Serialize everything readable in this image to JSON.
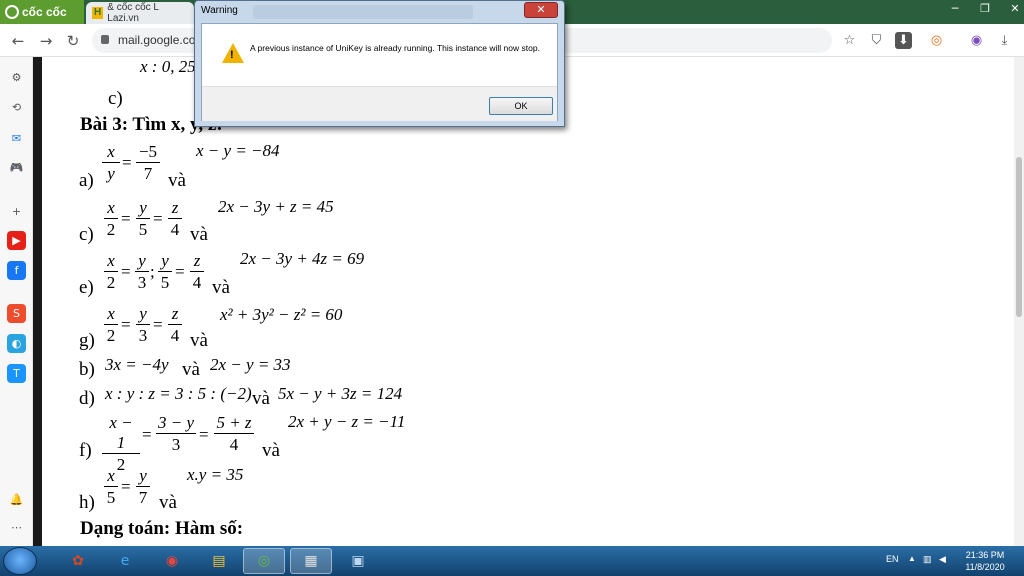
{
  "browser": {
    "brand_label": "cốc cốc",
    "tabs": [
      {
        "label": "& cốc cốc L Lazi.vn",
        "favicon": "H"
      }
    ],
    "window_controls": [
      "─",
      "❐",
      "✕"
    ],
    "url": "mail.google.com",
    "nav": {
      "back": "←",
      "forward": "→",
      "reload": "↻"
    },
    "toolbar_icons": {
      "star": "☆",
      "shield": "⛉",
      "download": "⬇",
      "extension": "◎",
      "account": "◉",
      "save": "⤓"
    }
  },
  "sidebar": {
    "items": [
      {
        "name": "settings-icon",
        "glyph": "⚙",
        "color": "#555555"
      },
      {
        "name": "history-icon",
        "glyph": "⟲",
        "color": "#555555"
      },
      {
        "name": "messenger-icon",
        "glyph": "✉",
        "color": "#1877f2"
      },
      {
        "name": "game-icon",
        "glyph": "🎮",
        "color": "#2e9e4d"
      },
      {
        "name": "add-icon",
        "glyph": "+",
        "color": "#555555"
      },
      {
        "name": "youtube-icon",
        "glyph": "▶",
        "color": "#e62117"
      },
      {
        "name": "facebook-icon",
        "glyph": "f",
        "color": "#1877f2"
      },
      {
        "name": "shopee-icon",
        "glyph": "S",
        "color": "#ee4d2d"
      },
      {
        "name": "app-icon",
        "glyph": "◐",
        "color": "#2aa4e0"
      },
      {
        "name": "tiki-icon",
        "glyph": "T",
        "color": "#1a94ff"
      },
      {
        "name": "notification-icon",
        "glyph": "🔔",
        "color": "#555555"
      },
      {
        "name": "more-icon",
        "glyph": "⋯",
        "color": "#555555"
      }
    ]
  },
  "dialog": {
    "title": "Warning",
    "message": "A previous instance of UniKey is already running. This instance will now stop.",
    "ok_label": "OK",
    "close_glyph": "✕"
  },
  "document": {
    "top_line": "x : 0, 25",
    "c_label_top": "c)",
    "section_title": "Bài 3: Tìm x, y, z:",
    "problems": {
      "a": {
        "label": "a)",
        "frac1": {
          "n": "x",
          "d": "y"
        },
        "frac2": {
          "n": "−5",
          "d": "7"
        },
        "va": "và",
        "cond": "x − y = −84"
      },
      "c": {
        "label": "c)",
        "f1": {
          "n": "x",
          "d": "2"
        },
        "f2": {
          "n": "y",
          "d": "5"
        },
        "f3": {
          "n": "z",
          "d": "4"
        },
        "va": "và",
        "cond": "2x − 3y + z = 45"
      },
      "e": {
        "label": "e)",
        "f1": {
          "n": "x",
          "d": "2"
        },
        "f2": {
          "n": "y",
          "d": "3"
        },
        "f3": {
          "n": "y",
          "d": "5"
        },
        "f4": {
          "n": "z",
          "d": "4"
        },
        "va": "và",
        "cond": "2x − 3y + 4z = 69"
      },
      "g": {
        "label": "g)",
        "f1": {
          "n": "x",
          "d": "2"
        },
        "f2": {
          "n": "y",
          "d": "3"
        },
        "f3": {
          "n": "z",
          "d": "4"
        },
        "va": "và",
        "cond": "x² + 3y² − z² = 60"
      },
      "b": {
        "label": "b)",
        "eq": "3x = −4y",
        "va": "và",
        "cond": "2x − y = 33"
      },
      "d": {
        "label": "d)",
        "eq": "x : y : z = 3 : 5 : (−2)",
        "va": "và",
        "cond": "5x − y + 3z = 124"
      },
      "f": {
        "label": "f)",
        "f1": {
          "n": "x − 1",
          "d": "2"
        },
        "f2": {
          "n": "3 − y",
          "d": "3"
        },
        "f3": {
          "n": "5 + z",
          "d": "4"
        },
        "va": "và",
        "cond": "2x + y − z = −11"
      },
      "h": {
        "label": "h)",
        "f1": {
          "n": "x",
          "d": "5"
        },
        "f2": {
          "n": "y",
          "d": "7"
        },
        "va": "và",
        "cond": "x.y = 35"
      }
    },
    "next_title": "Dạng toán: Hàm số:"
  },
  "taskbar": {
    "language": "EN",
    "time": "21:36 PM",
    "date": "11/8/2020",
    "apps": [
      {
        "name": "ccleaner-icon",
        "glyph": "✿",
        "color": "#d9481f"
      },
      {
        "name": "ie-icon",
        "glyph": "e",
        "color": "#3fa9f5"
      },
      {
        "name": "chrome-icon",
        "glyph": "◉",
        "color": "#e8453c"
      },
      {
        "name": "explorer-icon",
        "glyph": "▤",
        "color": "#f1c232"
      },
      {
        "name": "coccoc-icon",
        "glyph": "◎",
        "color": "#6dbb3e"
      },
      {
        "name": "unikey-icon",
        "glyph": "▦",
        "color": "#e0e0e0"
      },
      {
        "name": "paint-icon",
        "glyph": "▣",
        "color": "#bcd6f2"
      }
    ]
  }
}
